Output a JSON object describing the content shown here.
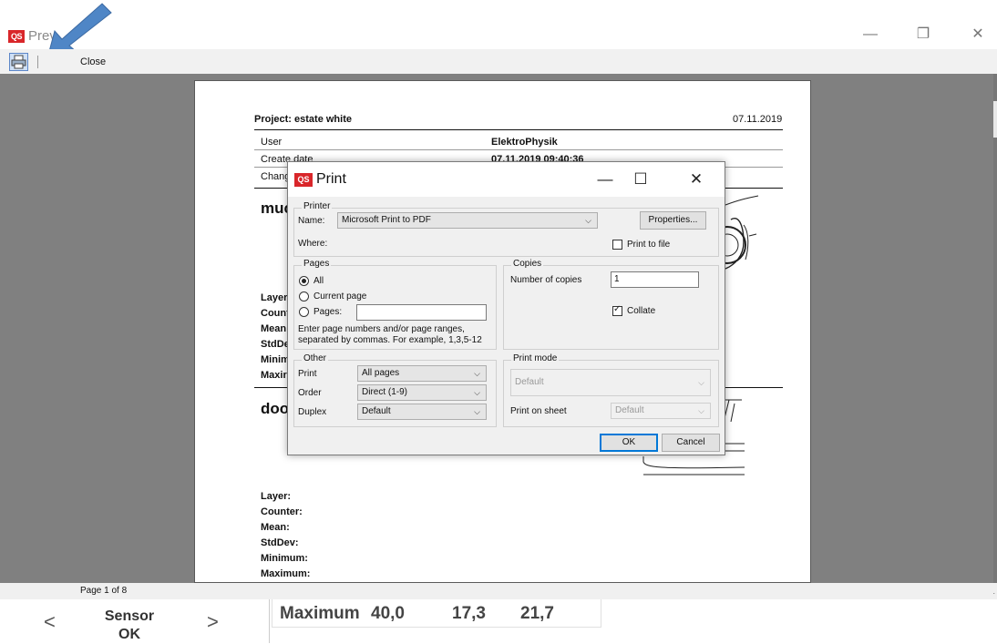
{
  "window": {
    "app_logo": "QS",
    "title": "Prev",
    "controls": {
      "minimize": "—",
      "restore": "❐",
      "close": "✕"
    }
  },
  "toolbar": {
    "print_icon": "printer-icon",
    "close_label": "Close"
  },
  "report": {
    "project_label": "Project: estate white",
    "date": "07.11.2019",
    "rows": [
      {
        "label": "User",
        "value": "ElektroPhysik"
      },
      {
        "label": "Create date",
        "value": "07.11.2019 09:40:36"
      },
      {
        "label": "Chang",
        "value": ""
      }
    ],
    "section1_title": "muc",
    "section1_stats": [
      "Layer",
      "Count",
      "Mean",
      "StdDe",
      "Minim",
      "Maxir"
    ],
    "section2_title": "doo",
    "section2_stats": [
      "Layer:",
      "Counter:",
      "Mean:",
      "StdDev:",
      "Minimum:",
      "Maximum:"
    ]
  },
  "status": {
    "page_info": "Page 1 of 8",
    "dot": "."
  },
  "bottom_panel": {
    "prev": "<",
    "next": ">",
    "sensor_line1": "Sensor",
    "sensor_line2": "OK",
    "stats": {
      "label": "Maximum",
      "v1": "40,0",
      "v2": "17,3",
      "v3": "21,7"
    }
  },
  "print_dialog": {
    "logo": "QS",
    "title": "Print",
    "controls": {
      "minimize": "—",
      "maximize": "☐",
      "close": "✕"
    },
    "printer": {
      "group_label": "Printer",
      "name_label": "Name:",
      "name_value": "Microsoft Print to PDF",
      "properties_button": "Properties...",
      "where_label": "Where:",
      "print_to_file_label": "Print to file",
      "print_to_file_checked": false
    },
    "pages": {
      "group_label": "Pages",
      "all_label": "All",
      "current_page_label": "Current page",
      "pages_label": "Pages:",
      "pages_value": "",
      "selected": "all",
      "hint_line1": "Enter page numbers and/or page ranges,",
      "hint_line2": "separated by commas. For example, 1,3,5-12"
    },
    "copies": {
      "group_label": "Copies",
      "number_label": "Number of copies",
      "number_value": "1",
      "collate_label": "Collate",
      "collate_checked": true
    },
    "other": {
      "group_label": "Other",
      "print_label": "Print",
      "print_value": "All pages",
      "order_label": "Order",
      "order_value": "Direct (1-9)",
      "duplex_label": "Duplex",
      "duplex_value": "Default"
    },
    "print_mode": {
      "group_label": "Print mode",
      "mode_value": "Default",
      "sheet_label": "Print on sheet",
      "sheet_value": "Default"
    },
    "ok_button": "OK",
    "cancel_button": "Cancel"
  }
}
